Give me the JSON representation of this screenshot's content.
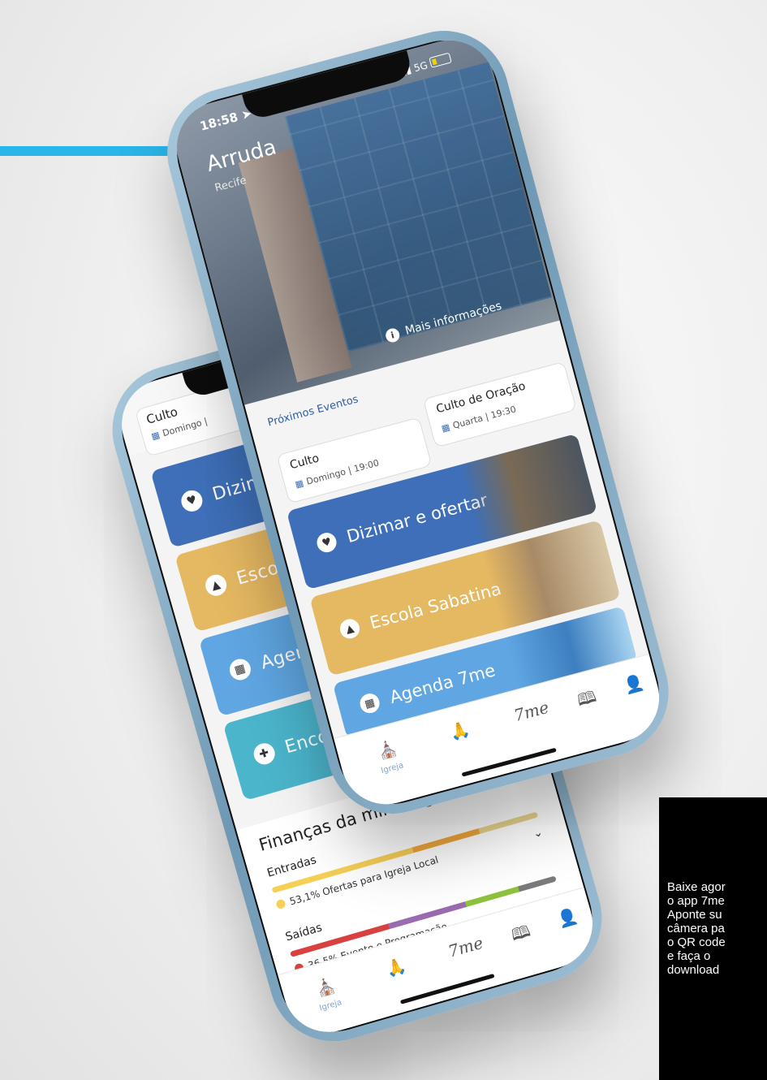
{
  "front": {
    "status": {
      "time": "18:58",
      "network": "5G"
    },
    "church": {
      "name": "Arruda",
      "city": "Recife"
    },
    "more_info": "Mais informações",
    "events_title": "Próximos Eventos",
    "events": [
      {
        "title": "Culto",
        "when": "Domingo | 19:00"
      },
      {
        "title": "Culto de Oração",
        "when": "Quarta | 19:30"
      }
    ],
    "cards": [
      "Dizimar e ofertar",
      "Escola Sabatina",
      "Agenda 7me"
    ],
    "nav": {
      "church_label": "Igreja",
      "brand": "7me"
    }
  },
  "back": {
    "event": {
      "title": "Culto",
      "when": "Domingo |"
    },
    "cards": [
      "Dizimar e oferta",
      "Escola Sabatina",
      "Agenda 7me",
      "Encontre uma i"
    ],
    "finance": {
      "title": "Finanças da minha igr",
      "income_label": "Entradas",
      "income_legend": "53,1% Ofertas para Igreja Local",
      "income_share": 53.1,
      "expense_label": "Saídas",
      "expense_legend": "36,5% Evento e Programação",
      "expense_share": 36.5
    },
    "nav": {
      "church_label": "Igreja",
      "brand": "7me"
    }
  },
  "promo": {
    "text": "Baixe agor\no app 7me\nAponte su\ncâmera pa\no QR code\ne faça o\ndownload"
  },
  "colors": {
    "accent": "#29b6e8",
    "blue_dark": "#3e6fb8",
    "gold": "#e5b862",
    "blue_light": "#5fa6e2",
    "teal": "#4bb5cc"
  }
}
